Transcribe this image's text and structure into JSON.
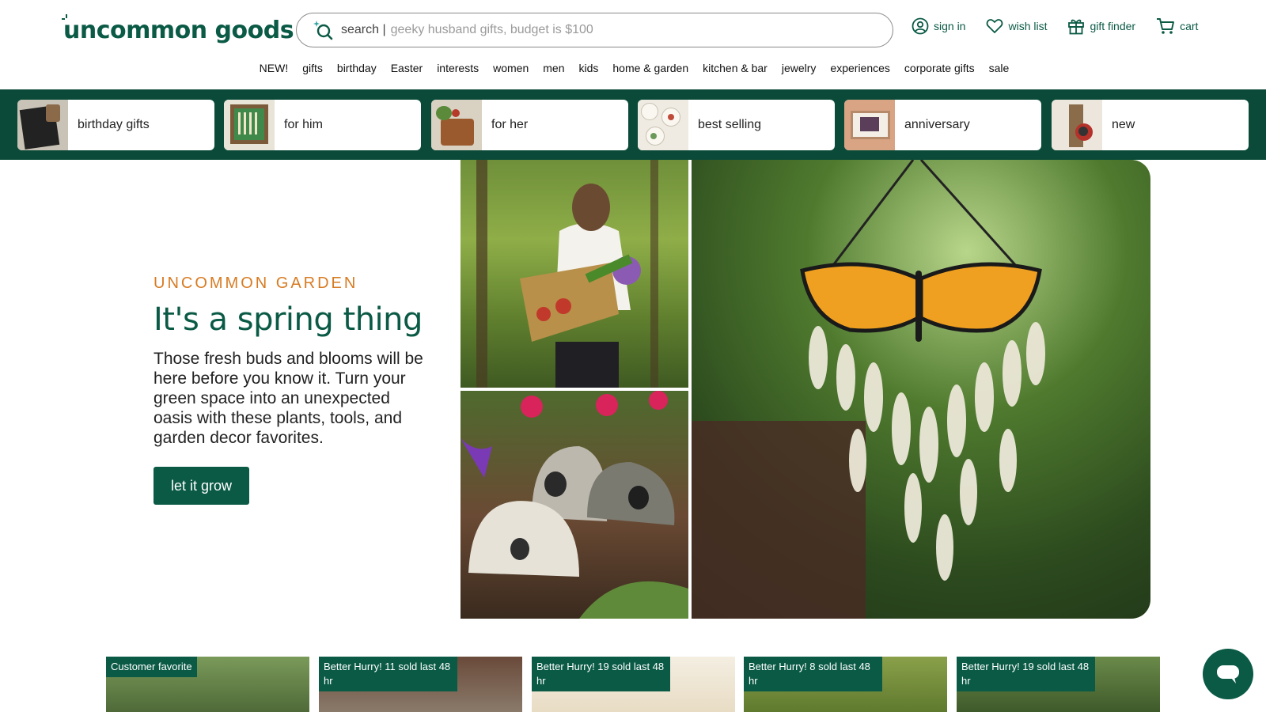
{
  "brand": {
    "name": "uncommon goods",
    "color": "#0a5a45",
    "accent": "#d77b22",
    "band_color": "#0b4a38"
  },
  "search": {
    "prefix": "search |",
    "placeholder": "geeky husband gifts, budget is $100",
    "icon": "sparkle-search-icon"
  },
  "utility_nav": [
    {
      "label": "sign in",
      "icon": "user-circle-icon"
    },
    {
      "label": "wish list",
      "icon": "heart-icon"
    },
    {
      "label": "gift finder",
      "icon": "gift-icon"
    },
    {
      "label": "cart",
      "icon": "cart-icon"
    }
  ],
  "category_nav": [
    "NEW!",
    "gifts",
    "birthday",
    "Easter",
    "interests",
    "women",
    "men",
    "kids",
    "home & garden",
    "kitchen & bar",
    "jewelry",
    "experiences",
    "corporate gifts",
    "sale"
  ],
  "quick_links": [
    {
      "label": "birthday gifts"
    },
    {
      "label": "for him"
    },
    {
      "label": "for her"
    },
    {
      "label": "best selling"
    },
    {
      "label": "anniversary"
    },
    {
      "label": "new"
    }
  ],
  "hero": {
    "eyebrow": "UNCOMMON GARDEN",
    "title": "It's a spring thing",
    "body": "Those fresh buds and blooms will be here before you know it. Turn your green space into an unexpected oasis with these plants, tools, and garden decor favorites.",
    "cta_label": "let it grow"
  },
  "products": [
    {
      "badge": "Customer favorite"
    },
    {
      "badge": "Better Hurry! 11 sold last 48 hr"
    },
    {
      "badge": "Better Hurry! 19 sold last 48 hr"
    },
    {
      "badge": "Better Hurry! 8 sold last 48 hr"
    },
    {
      "badge": "Better Hurry! 19 sold last 48 hr"
    }
  ],
  "chat": {
    "icon": "chat-bubble-icon"
  }
}
